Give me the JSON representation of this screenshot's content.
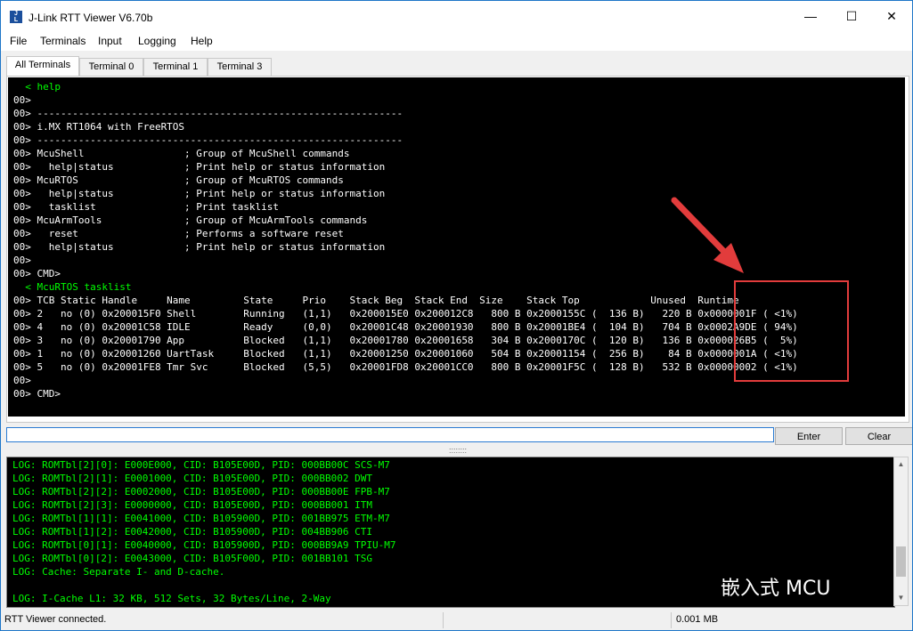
{
  "app": {
    "title": "J-Link RTT Viewer V6.70b",
    "icon_label": "J-Link",
    "window_controls": {
      "minimize": "—",
      "maximize": "☐",
      "close": "✕"
    }
  },
  "menu": [
    "File",
    "Terminals",
    "Input",
    "Logging",
    "Help"
  ],
  "tabs": [
    "All Terminals",
    "Terminal 0",
    "Terminal 1",
    "Terminal 3"
  ],
  "terminal_lines": [
    {
      "text": "  < help",
      "color": "green"
    },
    {
      "text": "00>",
      "color": "white"
    },
    {
      "text": "00> --------------------------------------------------------------",
      "color": "white"
    },
    {
      "text": "00> i.MX RT1064 with FreeRTOS",
      "color": "white"
    },
    {
      "text": "00> --------------------------------------------------------------",
      "color": "white"
    },
    {
      "text": "00> McuShell                 ; Group of McuShell commands",
      "color": "white"
    },
    {
      "text": "00>   help|status            ; Print help or status information",
      "color": "white"
    },
    {
      "text": "00> McuRTOS                  ; Group of McuRTOS commands",
      "color": "white"
    },
    {
      "text": "00>   help|status            ; Print help or status information",
      "color": "white"
    },
    {
      "text": "00>   tasklist               ; Print tasklist",
      "color": "white"
    },
    {
      "text": "00> McuArmTools              ; Group of McuArmTools commands",
      "color": "white"
    },
    {
      "text": "00>   reset                  ; Performs a software reset",
      "color": "white"
    },
    {
      "text": "00>   help|status            ; Print help or status information",
      "color": "white"
    },
    {
      "text": "00>",
      "color": "white"
    },
    {
      "text": "00> CMD>",
      "color": "white"
    },
    {
      "text": "  < McuRTOS tasklist",
      "color": "green"
    },
    {
      "text": "00> TCB Static Handle     Name         State     Prio    Stack Beg  Stack End  Size    Stack Top            Unused  Runtime",
      "color": "white"
    },
    {
      "text": "00> 2   no (0) 0x200015F0 Shell        Running   (1,1)   0x200015E0 0x200012C8   800 B 0x2000155C (  136 B)   220 B 0x0000001F ( <1%)",
      "color": "white"
    },
    {
      "text": "00> 4   no (0) 0x20001C58 IDLE         Ready     (0,0)   0x20001C48 0x20001930   800 B 0x20001BE4 (  104 B)   704 B 0x0002A9DE ( 94%)",
      "color": "white"
    },
    {
      "text": "00> 3   no (0) 0x20001790 App          Blocked   (1,1)   0x20001780 0x20001658   304 B 0x2000170C (  120 B)   136 B 0x000026B5 (  5%)",
      "color": "white"
    },
    {
      "text": "00> 1   no (0) 0x20001260 UartTask     Blocked   (1,1)   0x20001250 0x20001060   504 B 0x20001154 (  256 B)    84 B 0x0000001A ( <1%)",
      "color": "white"
    },
    {
      "text": "00> 5   no (0) 0x20001FE8 Tmr Svc      Blocked   (5,5)   0x20001FD8 0x20001CC0   800 B 0x20001F5C (  128 B)   532 B 0x00000002 ( <1%)",
      "color": "white"
    },
    {
      "text": "00>",
      "color": "white"
    },
    {
      "text": "00> CMD>",
      "color": "white"
    }
  ],
  "input": {
    "value": "",
    "enter_label": "Enter",
    "clear_label": "Clear"
  },
  "splitter_label": "::::::::",
  "log_lines": [
    "LOG: ROMTbl[2][0]: E000E000, CID: B105E00D, PID: 000BB00C SCS-M7",
    "LOG: ROMTbl[2][1]: E0001000, CID: B105E00D, PID: 000BB002 DWT",
    "LOG: ROMTbl[2][2]: E0002000, CID: B105E00D, PID: 000BB00E FPB-M7",
    "LOG: ROMTbl[2][3]: E0000000, CID: B105E00D, PID: 000BB001 ITM",
    "LOG: ROMTbl[1][1]: E0041000, CID: B105900D, PID: 001BB975 ETM-M7",
    "LOG: ROMTbl[1][2]: E0042000, CID: B105900D, PID: 004BB906 CTI",
    "LOG: ROMTbl[0][1]: E0040000, CID: B105900D, PID: 000BB9A9 TPIU-M7",
    "LOG: ROMTbl[0][2]: E0043000, CID: B105F00D, PID: 001BB101 TSG",
    "LOG: Cache: Separate I- and D-cache.",
    "",
    "LOG: I-Cache L1: 32 KB, 512 Sets, 32 Bytes/Line, 2-Way"
  ],
  "watermark": "嵌入式 MCU",
  "status": {
    "connection": "RTT Viewer connected.",
    "data_size": "0.001 MB"
  },
  "colors": {
    "highlight": "#e23c3c",
    "terminal_bg": "#000000",
    "terminal_green": "#00ff00"
  }
}
